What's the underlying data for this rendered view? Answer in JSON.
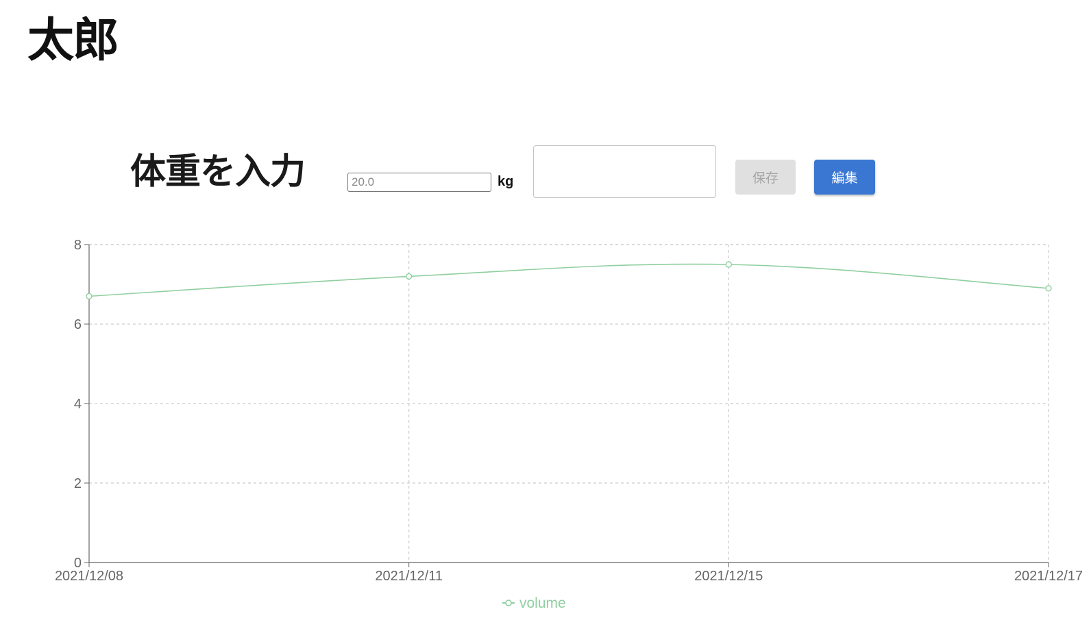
{
  "header": {
    "title": "太郎"
  },
  "entry": {
    "heading": "体重を入力",
    "weight_placeholder": "20.0",
    "weight_value": "",
    "unit": "kg",
    "memo_value": "",
    "save_label": "保存",
    "edit_label": "編集",
    "save_disabled": true
  },
  "colors": {
    "line": "#8fcf9f",
    "edit_button": "#3a77d2",
    "save_button_disabled": "#e0e0e0",
    "grid": "#cccccc",
    "axis": "#666666"
  },
  "chart_data": {
    "type": "line",
    "x": [
      "2021/12/08",
      "2021/12/11",
      "2021/12/15",
      "2021/12/17"
    ],
    "series": [
      {
        "name": "volume",
        "values": [
          6.7,
          7.2,
          7.5,
          6.9
        ]
      }
    ],
    "ylim": [
      0,
      8
    ],
    "yticks": [
      0,
      2,
      4,
      6,
      8
    ],
    "grid": true,
    "grid_style": "dashed",
    "curve": "smooth",
    "markers": "hollow-circle",
    "legend": "bottom-center"
  }
}
